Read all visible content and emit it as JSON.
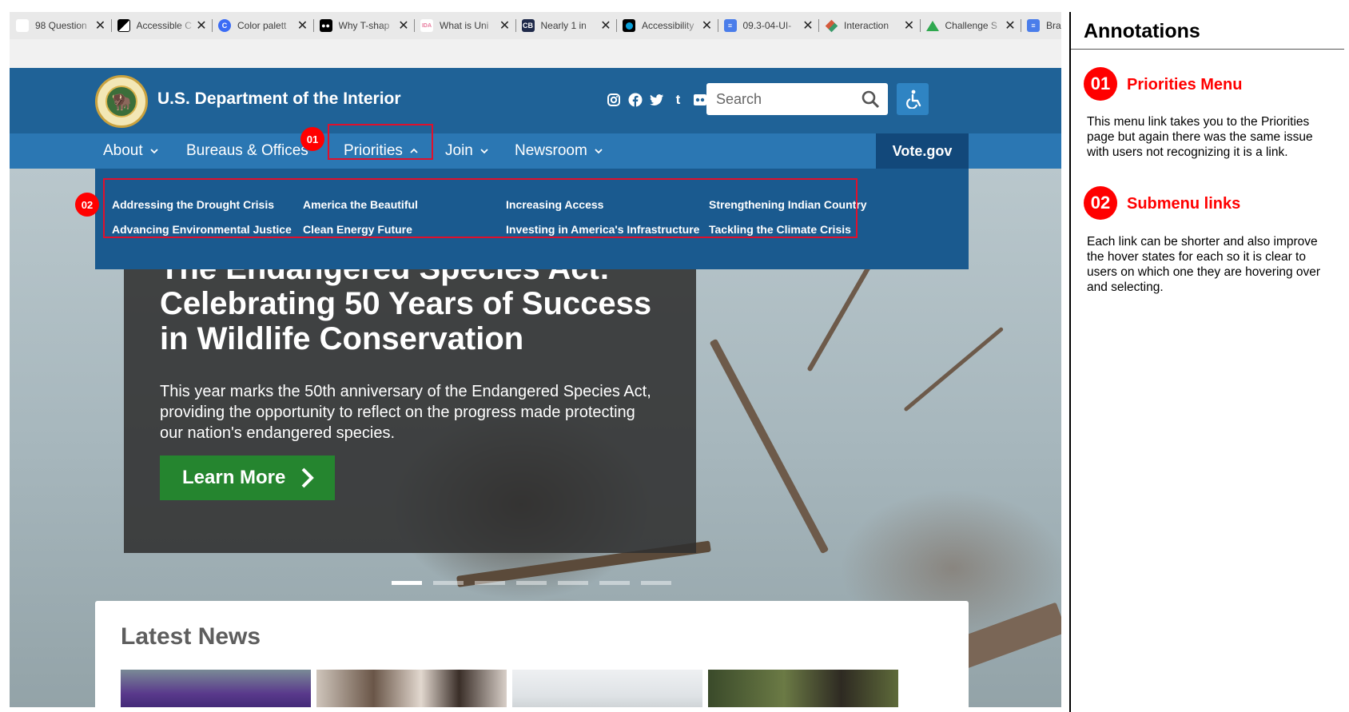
{
  "browser": {
    "tabs": [
      {
        "title": "98 Question",
        "favicon": "question-doc-icon",
        "color": "#ffffff"
      },
      {
        "title": "Accessible C",
        "favicon": "accessible-colors-icon",
        "color": "#000000"
      },
      {
        "title": "Color palett",
        "favicon": "coolors-icon",
        "color": "#3b6cf5"
      },
      {
        "title": "Why T-shap",
        "favicon": "medium-icon",
        "color": "#000000"
      },
      {
        "title": "What is Uni",
        "favicon": "ida-icon",
        "color": "#e87c9e"
      },
      {
        "title": "Nearly 1 in",
        "favicon": "cb-icon",
        "color": "#1f2a4a"
      },
      {
        "title": "Accessibility",
        "favicon": "circle-icon",
        "color": "#0a9fd8"
      },
      {
        "title": "09.3-04-UI-",
        "favicon": "google-docs-icon",
        "color": "#4a7dea"
      },
      {
        "title": "Interaction",
        "favicon": "diamond-icon",
        "color": "#d45a3c"
      },
      {
        "title": "Challenge S",
        "favicon": "google-drive-icon",
        "color": "#2fa84f"
      },
      {
        "title": "Brand-Po",
        "favicon": "google-docs-icon",
        "color": "#4a7dea"
      }
    ]
  },
  "site": {
    "title": "U.S. Department of the Interior",
    "search_placeholder": "Search",
    "social": [
      "instagram-icon",
      "facebook-icon",
      "twitter-icon",
      "tumblr-icon",
      "flickr-icon",
      "youtube-icon"
    ],
    "colors": {
      "header": "#1f6297",
      "nav": "#2b77b3",
      "dropdown": "#1a5a8f",
      "vote": "#12487a",
      "cta": "#25852f",
      "annotation": "#ff0000"
    }
  },
  "nav": {
    "items": [
      {
        "label": "About"
      },
      {
        "label": "Bureaus & Offices"
      },
      {
        "label": "Priorities"
      },
      {
        "label": "Join"
      },
      {
        "label": "Newsroom"
      }
    ],
    "vote_label": "Vote.gov"
  },
  "dropdown": {
    "links": [
      "Addressing the Drought Crisis",
      "America the Beautiful",
      "Increasing Access",
      "Strengthening Indian Country",
      "Advancing Environmental Justice",
      "Clean Energy Future",
      "Investing in America's Infrastructure",
      "Tackling the Climate Crisis"
    ]
  },
  "hero": {
    "title_top": "The Endangered Species Act:",
    "title": "Celebrating 50 Years of Success in Wildlife Conservation",
    "body": "This year marks the 50th anniversary of the Endangered Species Act, providing the opportunity to reflect on the progress made protecting our nation's endangered species.",
    "cta": "Learn More",
    "slides_total": 7,
    "active_slide": 1
  },
  "news": {
    "heading": "Latest News"
  },
  "markers": [
    "01",
    "02"
  ],
  "annotations": {
    "title": "Annotations",
    "items": [
      {
        "num": "01",
        "heading": "Priorities Menu",
        "text": "This menu link takes you to the Priorities page but again there was the same issue with users not recognizing it is a link."
      },
      {
        "num": "02",
        "heading": "Submenu links",
        "text": "Each link can be shorter and also improve the hover states for each so it is clear to users on which one they are hovering over and selecting."
      }
    ]
  }
}
